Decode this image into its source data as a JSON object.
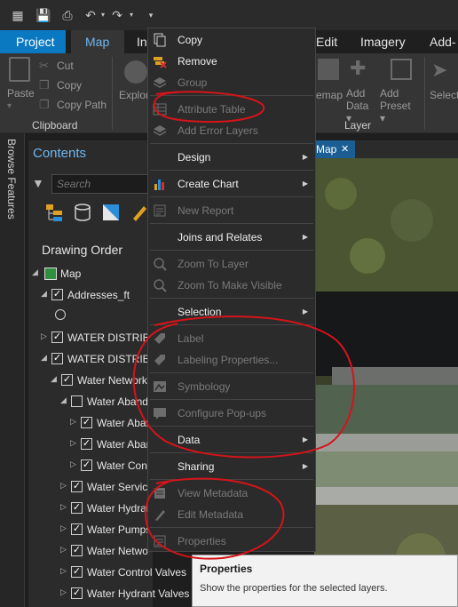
{
  "ribbon": {
    "tabs": [
      "Project",
      "Map",
      "In",
      "Edit",
      "Imagery",
      "Add-I"
    ],
    "active_tab": "Map",
    "clipboard": {
      "paste": "Paste",
      "cut": "Cut",
      "copy": "Copy",
      "copy_path": "Copy Path",
      "group_label": "Clipboard"
    },
    "explore": "Explor",
    "basemap": "emap",
    "add_data": "Add Data ▾",
    "add_preset": "Add Preset ▾",
    "select": "Select",
    "layer_group_label": "Layer"
  },
  "browse_features": "Browse Features",
  "contents": {
    "title": "Contents",
    "search_placeholder": "Search",
    "drawing_order": "Drawing Order",
    "layers": [
      {
        "name": "Map",
        "checked": false,
        "expanded": true
      },
      {
        "name": "Addresses_ft",
        "checked": true,
        "expanded": true
      },
      {
        "name": "WATER DISTRIBU",
        "checked": true,
        "expanded": false
      },
      {
        "name": "WATER DISTRIBU",
        "checked": true,
        "expanded": true
      },
      {
        "name": "Water Network",
        "checked": true,
        "expanded": true
      },
      {
        "name": "Water Aband",
        "checked": false,
        "expanded": true
      },
      {
        "name": "Water Aban",
        "checked": true,
        "expanded": false
      },
      {
        "name": "Water Aban",
        "checked": true,
        "expanded": false
      },
      {
        "name": "Water Cons",
        "checked": true,
        "expanded": false
      },
      {
        "name": "Water Service",
        "checked": true,
        "expanded": false
      },
      {
        "name": "Water Hydran",
        "checked": true,
        "expanded": false
      },
      {
        "name": "Water Pumps",
        "checked": true,
        "expanded": false
      },
      {
        "name": "Water Netwo",
        "checked": true,
        "expanded": false
      },
      {
        "name": "Water Control Valves",
        "checked": true,
        "expanded": false
      },
      {
        "name": "Water Hydrant Valves",
        "checked": true,
        "expanded": false
      }
    ]
  },
  "map_tab": {
    "label": "Map",
    "close": "✕"
  },
  "context_menu": {
    "items": [
      {
        "label": "Copy",
        "enabled": true,
        "submenu": false,
        "icon": "copy-icon"
      },
      {
        "label": "Remove",
        "enabled": true,
        "submenu": false,
        "icon": "remove-icon"
      },
      {
        "label": "Group",
        "enabled": false,
        "submenu": false,
        "icon": "group-icon"
      },
      {
        "label": "Attribute Table",
        "enabled": false,
        "submenu": false,
        "icon": "table-icon"
      },
      {
        "label": "Add Error Layers",
        "enabled": false,
        "submenu": false,
        "icon": "error-layers-icon"
      },
      {
        "label": "Design",
        "enabled": true,
        "submenu": true,
        "icon": ""
      },
      {
        "label": "Create Chart",
        "enabled": true,
        "submenu": true,
        "icon": "chart-icon"
      },
      {
        "label": "New Report",
        "enabled": false,
        "submenu": false,
        "icon": "report-icon"
      },
      {
        "label": "Joins and Relates",
        "enabled": true,
        "submenu": true,
        "icon": ""
      },
      {
        "label": "Zoom To Layer",
        "enabled": false,
        "submenu": false,
        "icon": "zoom-layer-icon"
      },
      {
        "label": "Zoom To Make Visible",
        "enabled": false,
        "submenu": false,
        "icon": "zoom-visible-icon"
      },
      {
        "label": "Selection",
        "enabled": true,
        "submenu": true,
        "icon": ""
      },
      {
        "label": "Label",
        "enabled": false,
        "submenu": false,
        "icon": "label-icon"
      },
      {
        "label": "Labeling Properties...",
        "enabled": false,
        "submenu": false,
        "icon": "labeling-properties-icon"
      },
      {
        "label": "Symbology",
        "enabled": false,
        "submenu": false,
        "icon": "symbology-icon"
      },
      {
        "label": "Configure Pop-ups",
        "enabled": false,
        "submenu": false,
        "icon": "popups-icon"
      },
      {
        "label": "Data",
        "enabled": true,
        "submenu": true,
        "icon": ""
      },
      {
        "label": "Sharing",
        "enabled": true,
        "submenu": true,
        "icon": ""
      },
      {
        "label": "View Metadata",
        "enabled": false,
        "submenu": false,
        "icon": "view-metadata-icon"
      },
      {
        "label": "Edit Metadata",
        "enabled": false,
        "submenu": false,
        "icon": "edit-metadata-icon"
      },
      {
        "label": "Properties",
        "enabled": false,
        "submenu": false,
        "icon": "properties-icon"
      }
    ]
  },
  "tooltip": {
    "title": "Properties",
    "description": "Show the properties for the selected layers."
  },
  "colors": {
    "accent": "#0b79c2",
    "active_tab_text": "#6fb8f0",
    "annotation": "#d4141a"
  }
}
